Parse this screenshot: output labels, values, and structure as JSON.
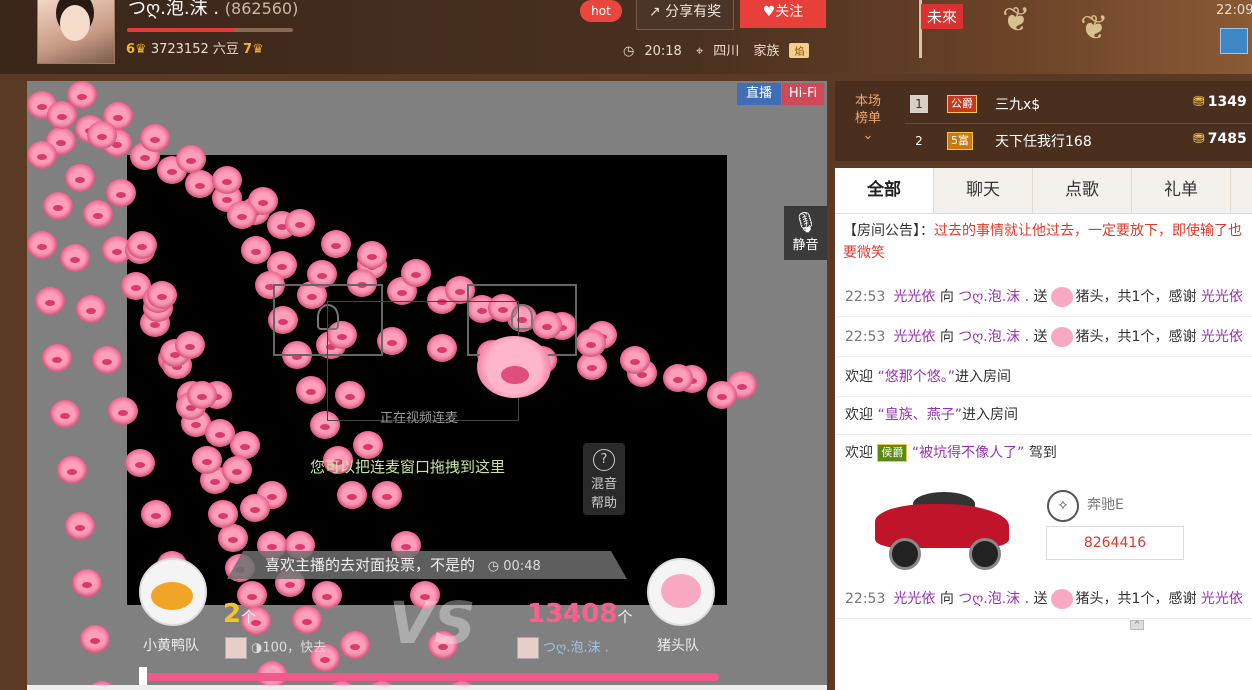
{
  "header": {
    "host_name": "つღ.泡.沫 .",
    "host_id": "(862560)",
    "level_left": "6",
    "beans": "3723152 六豆",
    "level_right": "7",
    "level_progress": 0.65,
    "hot_label": "hot",
    "share_label": "分享有奖",
    "follow_label": "关注",
    "time": "20:18",
    "location": "四川",
    "family_label": "家族",
    "family_badge": "焰",
    "flag_text": "未來",
    "clock": "22:09"
  },
  "video": {
    "live_label": "直播",
    "hifi_label": "Hi-Fi",
    "mute_label": "静音",
    "connecting_text": "正在视频连麦",
    "drag_hint": "您可以把连麦窗口拖拽到这里",
    "mix_help_line1": "混音",
    "mix_help_line2": "帮助",
    "vote_question": "喜欢主播的去对面投票，不是的",
    "vote_timer": "00:48",
    "team_left": "小黄鸭队",
    "team_right": "猪头队",
    "count_left": "2",
    "count_right": "13408",
    "count_unit": "个",
    "vs": "VS",
    "supporter_left": "◑100，快去",
    "supporter_right": "つღ.泡.沫 .",
    "vote_progress": 0.0001
  },
  "rank": {
    "title_line1": "本场",
    "title_line2": "榜单",
    "rows": [
      {
        "num": "1",
        "badge": "公爵",
        "name": "三九x$",
        "score": "1349"
      },
      {
        "num": "2",
        "badge": "5富",
        "name": "天下任我行168",
        "score": "7485"
      }
    ]
  },
  "chat": {
    "tabs": [
      "全部",
      "聊天",
      "点歌",
      "礼单"
    ],
    "notice_label": "【房间公告】：",
    "notice_text": "过去的事情就让他过去，一定要放下，即使输了也要微笑",
    "gift_msgs": [
      {
        "time": "22:53",
        "from": "光光依",
        "verb": "向",
        "to": "つღ.泡.沫 .",
        "send": "送",
        "gift": "猪头",
        "rest": "，共1个，感谢",
        "thanks": "光光依"
      },
      {
        "time": "22:53",
        "from": "光光依",
        "verb": "向",
        "to": "つღ.泡.沫 .",
        "send": "送",
        "gift": "猪头",
        "rest": "，共1个，感谢",
        "thanks": "光光依"
      }
    ],
    "welcome1_prefix": "欢迎",
    "welcome1_name": "“悠那个悠。”",
    "welcome1_suffix": "进入房间",
    "welcome2_prefix": "欢迎",
    "welcome2_name": "“皇族、燕子”",
    "welcome2_suffix": "进入房间",
    "welcome3_prefix": "欢迎",
    "welcome3_badge": "侯爵",
    "welcome3_name": "“被坑得不像人了”",
    "welcome3_suffix": "驾到",
    "car_name": "奔驰E",
    "car_plate": "8264416",
    "last_msg": {
      "time": "22:53",
      "from": "光光依",
      "verb": "向",
      "to": "つღ.泡.沫 .",
      "send": "送",
      "gift": "猪头",
      "rest": "，共1个，感谢",
      "thanks": "光光依"
    }
  }
}
